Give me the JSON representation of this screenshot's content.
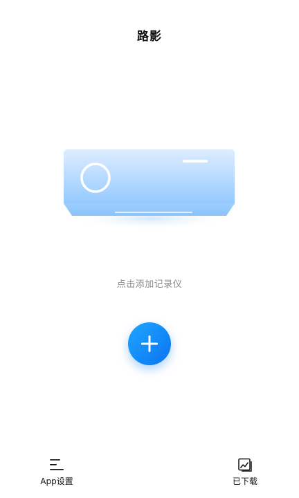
{
  "header": {
    "title": "路影"
  },
  "main": {
    "device_illustration_icon": "projector-device-illustration",
    "hint": "点击添加记录仪",
    "add_button_icon": "plus-icon"
  },
  "bottom_nav": {
    "items": [
      {
        "label": "App设置",
        "icon": "menu-icon"
      },
      {
        "label": "已下载",
        "icon": "gallery-icon"
      }
    ]
  },
  "colors": {
    "accent": "#0b73f0",
    "accent_light": "#1fa6ff",
    "device_top": "#dfeeff",
    "device_bottom": "#8fc8ff",
    "hint_text": "#8a8a8a"
  }
}
